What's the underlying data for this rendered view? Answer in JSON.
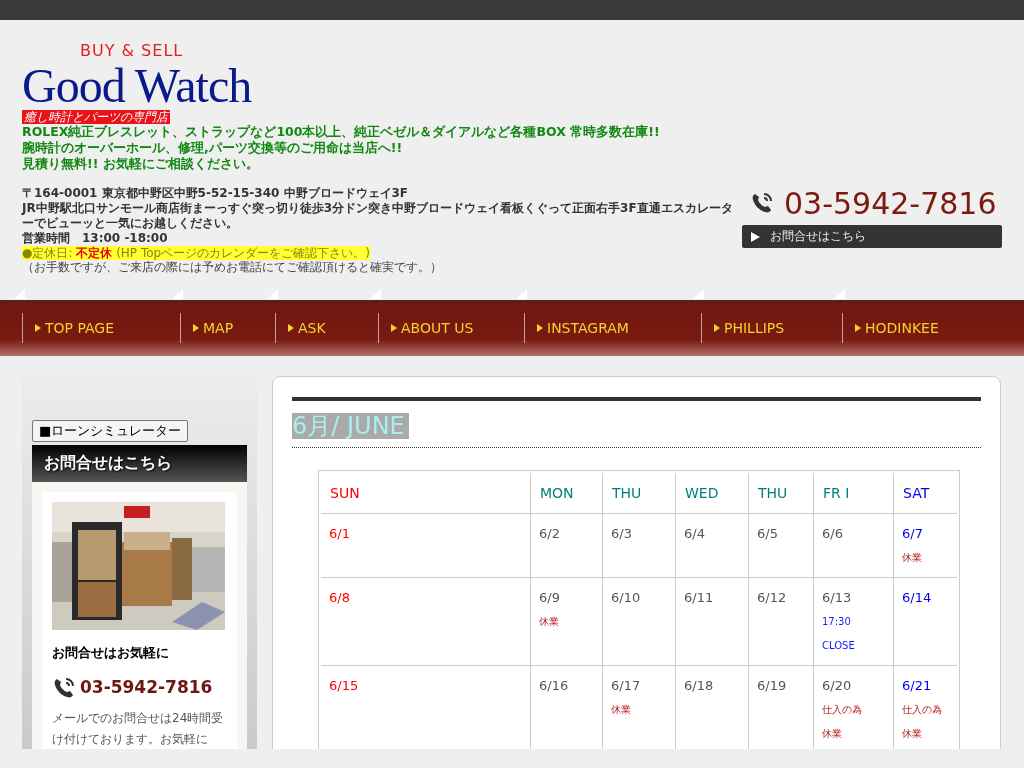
{
  "header": {
    "tagline_top": "BUY & SELL",
    "logo": "Good Watch",
    "subtitle": "癒し時計とパーツの専門店",
    "promo_lines": [
      "ROLEX純正ブレスレット、ストラップなど100本以上、純正ベゼル＆ダイアルなど各種BOX 常時多数在庫!!",
      "腕時計のオーバーホール、修理,パーツ交換等のご用命は当店へ!!",
      "見積り無料!! お気軽にご相談ください。"
    ],
    "address": "〒164-0001 東京都中野区中野5-52-15-340 中野ブロードウェイ3F",
    "directions": "JR中野駅北口サンモール商店街まーっすぐ突っ切り徒歩3分ドン突き中野ブロードウェイ看板くぐって正面右手3F直通エスカレーターでビューッと一気にお越しください。",
    "hours": "営業時間　13:00 -18:00",
    "holiday": {
      "label": "●定休日: ",
      "value": "不定休",
      "note": " (HP Topページのカレンダーをご確認下さい。)"
    },
    "holiday_note": "（お手数ですが、ご来店の際には予めお電話にてご確認頂けると確実です。）",
    "phone": "03-5942-7816",
    "contact_button": "お問合せはこちら"
  },
  "nav": [
    "TOP PAGE",
    "MAP",
    "ASK",
    "ABOUT US",
    "INSTAGRAM",
    "PHILLIPS",
    "HODINKEE"
  ],
  "sidebar": {
    "loan_button": "■ローンシミュレーター",
    "heading": "お問合せはこちら",
    "caption": "お問合せはお気軽に",
    "phone": "03-5942-7816",
    "text": "メールでのお問合せは24時間受け付けております。お気軽に"
  },
  "calendar": {
    "title": "6月/ JUNE",
    "columns": [
      {
        "label": "SUN",
        "kind": "sun"
      },
      {
        "label": "MON",
        "kind": "weekday"
      },
      {
        "label": "THU",
        "kind": "weekday"
      },
      {
        "label": "WED",
        "kind": "weekday"
      },
      {
        "label": "THU",
        "kind": "weekday"
      },
      {
        "label": "FR I",
        "kind": "weekday"
      },
      {
        "label": "SAT",
        "kind": "sat"
      }
    ],
    "rows": [
      [
        {
          "date": "6/1"
        },
        {
          "date": "6/2"
        },
        {
          "date": "6/3"
        },
        {
          "date": "6/4"
        },
        {
          "date": "6/5"
        },
        {
          "date": "6/6"
        },
        {
          "date": "6/7",
          "notes": [
            {
              "text": "休業",
              "kind": "closed"
            }
          ]
        }
      ],
      [
        {
          "date": "6/8"
        },
        {
          "date": "6/9",
          "notes": [
            {
              "text": "休業",
              "kind": "closed"
            }
          ]
        },
        {
          "date": "6/10"
        },
        {
          "date": "6/11"
        },
        {
          "date": "6/12"
        },
        {
          "date": "6/13",
          "notes": [
            {
              "text": "17:30",
              "kind": "time"
            },
            {
              "text": "CLOSE",
              "kind": "time"
            }
          ]
        },
        {
          "date": "6/14"
        }
      ],
      [
        {
          "date": "6/15"
        },
        {
          "date": "6/16"
        },
        {
          "date": "6/17",
          "notes": [
            {
              "text": "休業",
              "kind": "closed"
            }
          ]
        },
        {
          "date": "6/18"
        },
        {
          "date": "6/19"
        },
        {
          "date": "6/20",
          "notes": [
            {
              "text": "仕入の為",
              "kind": "closed"
            },
            {
              "text": "休業",
              "kind": "closed"
            }
          ]
        },
        {
          "date": "6/21",
          "notes": [
            {
              "text": "仕入の為",
              "kind": "closed"
            },
            {
              "text": "休業",
              "kind": "closed"
            }
          ]
        }
      ]
    ]
  }
}
